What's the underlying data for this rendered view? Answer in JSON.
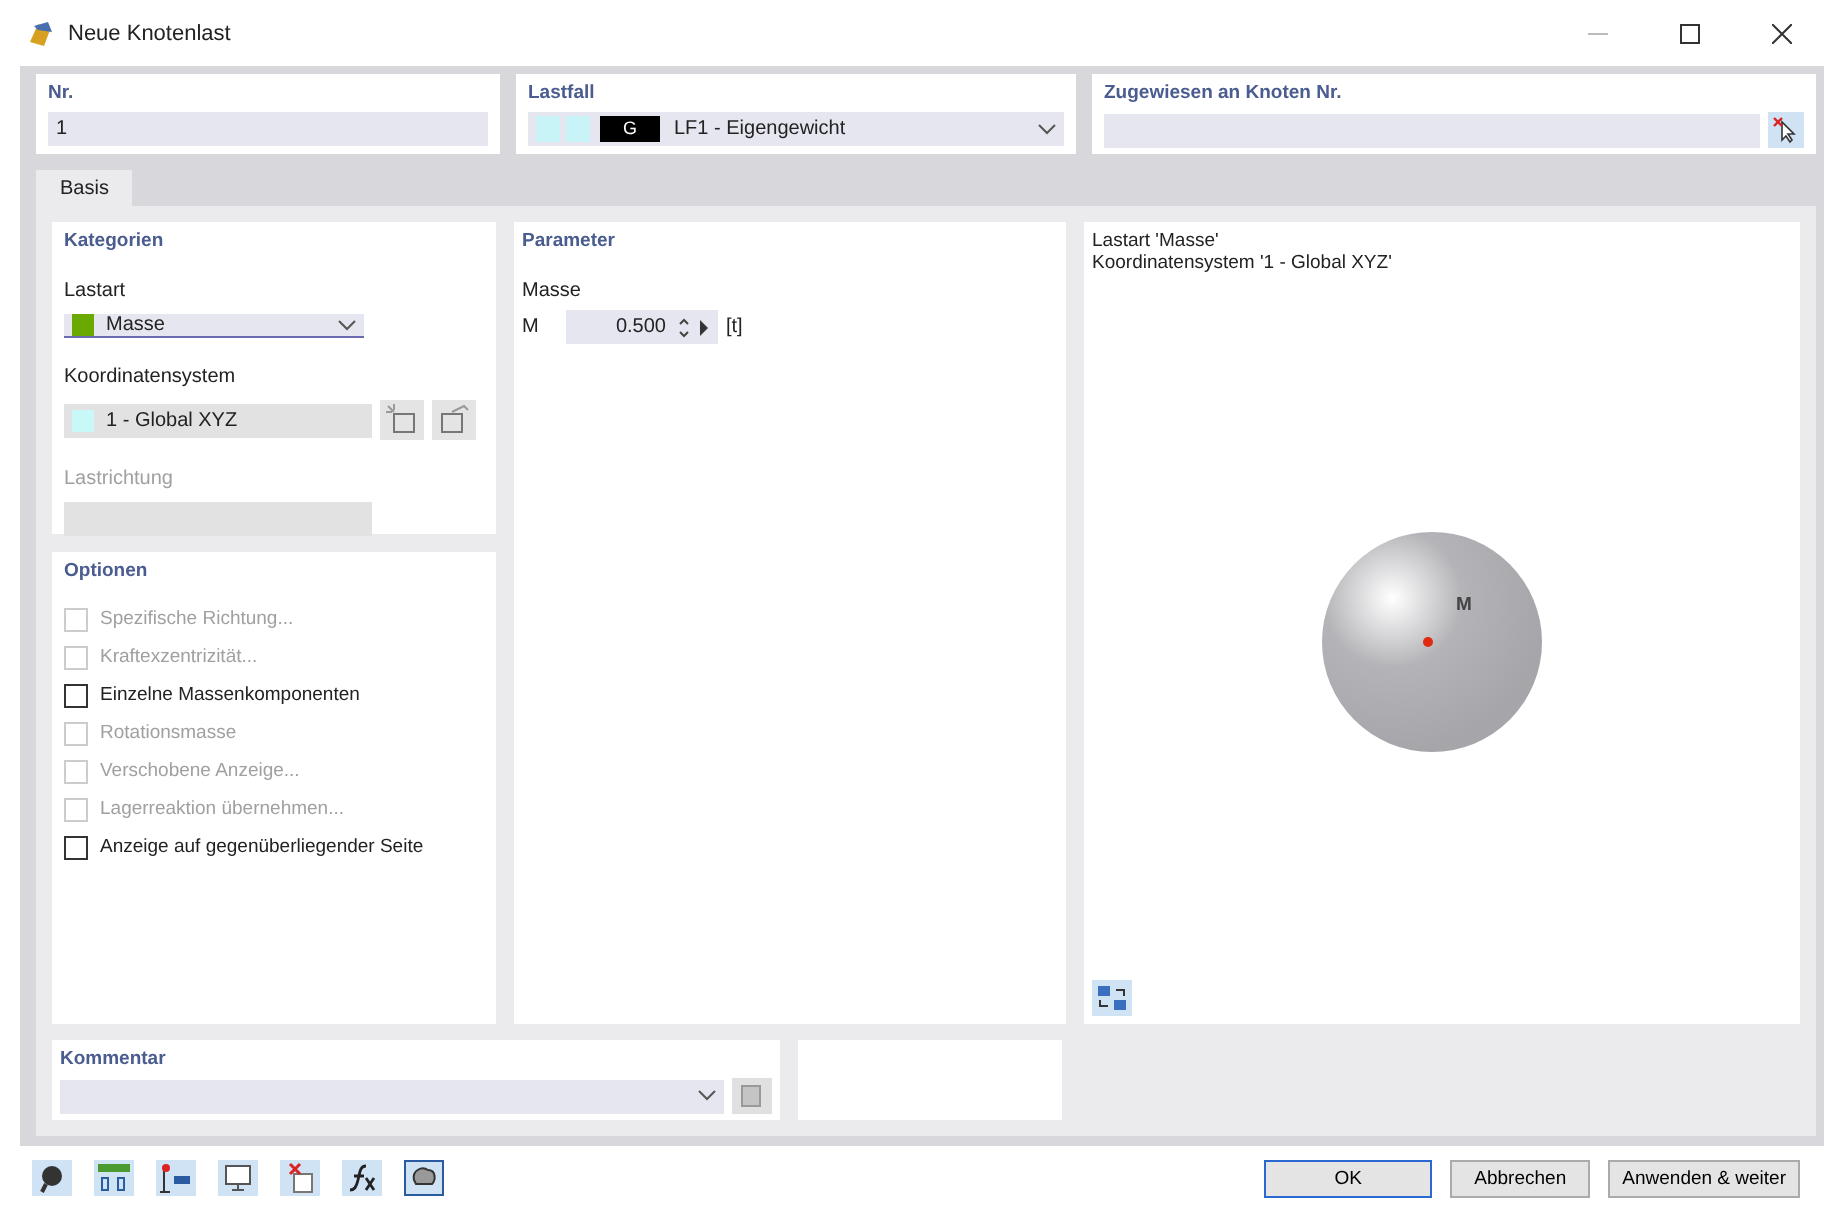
{
  "window": {
    "title": "Neue Knotenlast"
  },
  "nr": {
    "label": "Nr.",
    "value": "1"
  },
  "lastfall": {
    "label": "Lastfall",
    "swatches": [
      {
        "color": "#c8f4f8"
      },
      {
        "color": "#c8f4f8"
      }
    ],
    "badge": "G",
    "value": "LF1 - Eigengewicht"
  },
  "zugewiesen": {
    "label": "Zugewiesen an Knoten Nr."
  },
  "tabs": [
    {
      "label": "Basis",
      "selected": true
    }
  ],
  "kategorien": {
    "title": "Kategorien",
    "lastart": {
      "label": "Lastart",
      "color": "#6aaa00",
      "value": "Masse"
    },
    "koordinatensystem": {
      "label": "Koordinatensystem",
      "color": "#c8f8f8",
      "value": "1 - Global XYZ"
    },
    "lastrichtung": {
      "label": "Lastrichtung",
      "disabled": true
    }
  },
  "optionen": {
    "title": "Optionen",
    "items": [
      {
        "label": "Spezifische Richtung...",
        "checked": false,
        "disabled": true
      },
      {
        "label": "Kraftexzentrizität...",
        "checked": false,
        "disabled": true
      },
      {
        "label": "Einzelne Massenkomponenten",
        "checked": false,
        "disabled": false
      },
      {
        "label": "Rotationsmasse",
        "checked": false,
        "disabled": true
      },
      {
        "label": "Verschobene Anzeige...",
        "checked": false,
        "disabled": true
      },
      {
        "label": "Lagerreaktion übernehmen...",
        "checked": false,
        "disabled": true
      },
      {
        "label": "Anzeige auf gegenüberliegender Seite",
        "checked": false,
        "disabled": false
      }
    ]
  },
  "parameter": {
    "title": "Parameter",
    "group": "Masse",
    "symbol": "M",
    "value": "0.500",
    "unit": "[t]"
  },
  "preview": {
    "lines": [
      "Lastart 'Masse'",
      "Koordinatensystem '1 - Global XYZ'"
    ],
    "mass_label": "M"
  },
  "kommentar": {
    "label": "Kommentar"
  },
  "buttons": [
    {
      "label": "OK",
      "default": true
    },
    {
      "label": "Abbrechen",
      "default": false
    },
    {
      "label": "Anwenden & weiter",
      "default": false
    }
  ]
}
